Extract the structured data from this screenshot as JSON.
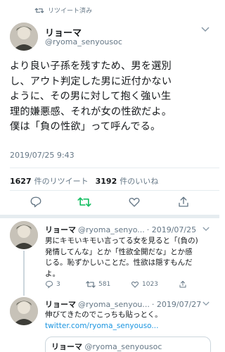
{
  "retweet_label": "リツイート済み",
  "tweet": {
    "author_name": "リョーマ",
    "author_handle": "@ryoma_senyousoc",
    "text_lines": [
      "より良い子孫を残すため、男を選別",
      "し、アウト判定した男に近付かない",
      "ように、その男に対して抱く強い生",
      "理的嫌悪感、それが女の性欲だよ。",
      "僕は「負の性欲」って呼んでる。"
    ],
    "timestamp": "2019/07/25 9:43",
    "retweet_count": "1627",
    "retweet_label": "件のリツイート",
    "like_count": "3192",
    "like_label": "件のいいね"
  },
  "icons": {
    "retweet_banner": "retweet-icon",
    "reply": "reply-icon",
    "retweet": "retweet-icon",
    "like": "heart-icon",
    "share": "share-icon",
    "more": "chevron-down-icon"
  },
  "colors": {
    "retweet_active": "#17bf63",
    "link": "#1b95e0",
    "muted": "#657786"
  },
  "replies": [
    {
      "author_name": "リョーマ",
      "author_handle": "@ryoma_senyo...",
      "date": "· 2019/07/25",
      "text_lines": [
        "男にキモいキモい言ってる女を見ると「(負の)",
        "発情してんな」とか「性欲全開だな」とか感",
        "じる。恥ずかしいことだ。性欲は隠すもんだ",
        "よ。"
      ],
      "reply_count": "3",
      "retweet_count": "581",
      "like_count": "1023"
    },
    {
      "author_name": "リョーマ",
      "author_handle": "@ryoma_senyou...",
      "date": "· 2019/07/27",
      "text_lines": [
        "伸びてきたのでこっちも貼っとく。"
      ],
      "link": "twitter.com/ryoma_senyouso..."
    }
  ],
  "quote": {
    "author_name": "リョーマ",
    "author_handle": "@ryoma_senyousoc"
  }
}
